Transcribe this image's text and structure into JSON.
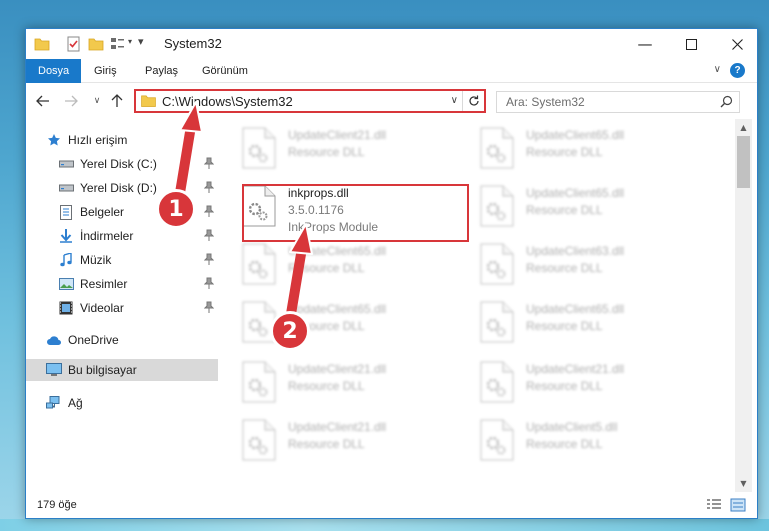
{
  "window": {
    "title": "System32"
  },
  "ribbon": {
    "tabs": [
      "Dosya",
      "Giriş",
      "Paylaş",
      "Görünüm"
    ],
    "help": "?"
  },
  "address": {
    "path": "C:\\Windows\\System32"
  },
  "search": {
    "placeholder": "Ara: System32"
  },
  "nav": {
    "items": [
      {
        "label": "Hızlı erişim",
        "icon": "star-icon"
      },
      {
        "label": "Yerel Disk (C:)",
        "icon": "drive-icon",
        "pinned": true
      },
      {
        "label": "Yerel Disk (D:)",
        "icon": "drive-icon",
        "pinned": true
      },
      {
        "label": "Belgeler",
        "icon": "documents-icon",
        "pinned": true
      },
      {
        "label": "İndirmeler",
        "icon": "downloads-icon",
        "pinned": true
      },
      {
        "label": "Müzik",
        "icon": "music-icon",
        "pinned": true
      },
      {
        "label": "Resimler",
        "icon": "pictures-icon",
        "pinned": true
      },
      {
        "label": "Videolar",
        "icon": "videos-icon",
        "pinned": true
      },
      {
        "label": "OneDrive",
        "icon": "cloud-icon"
      },
      {
        "label": "Bu bilgisayar",
        "icon": "computer-icon",
        "selected": true
      },
      {
        "label": "Ağ",
        "icon": "network-icon"
      }
    ]
  },
  "files": {
    "left": [
      {
        "name": "UpdateClient21.dll",
        "desc": "Resource DLL"
      },
      {
        "name": "inkprops.dll",
        "version": "3.5.0.1176",
        "desc": "InkProps Module"
      },
      {
        "name": "UpdateClient65.dll",
        "desc": "Resource DLL"
      },
      {
        "name": "UpdateClient65.dll",
        "desc": "Resource DLL"
      },
      {
        "name": "UpdateClient21.dll",
        "desc": "Resource DLL"
      },
      {
        "name": "UpdateClient21.dll",
        "desc": "Resource DLL"
      }
    ],
    "right": [
      {
        "name": "UpdateClient65.dll",
        "desc": "Resource DLL"
      },
      {
        "name": "UpdateClient65.dll",
        "desc": "Resource DLL"
      },
      {
        "name": "UpdateClient63.dll",
        "desc": "Resource DLL"
      },
      {
        "name": "UpdateClient65.dll",
        "desc": "Resource DLL"
      },
      {
        "name": "UpdateClient21.dll",
        "desc": "Resource DLL"
      },
      {
        "name": "UpdateClient5.dll",
        "desc": "Resource DLL"
      }
    ]
  },
  "status": {
    "count": "179 öğe"
  },
  "annotations": {
    "step1": "1",
    "step2": "2"
  },
  "colors": {
    "accent": "#1979ca",
    "highlight": "#d8363a",
    "selected": "#d9d9d9"
  }
}
